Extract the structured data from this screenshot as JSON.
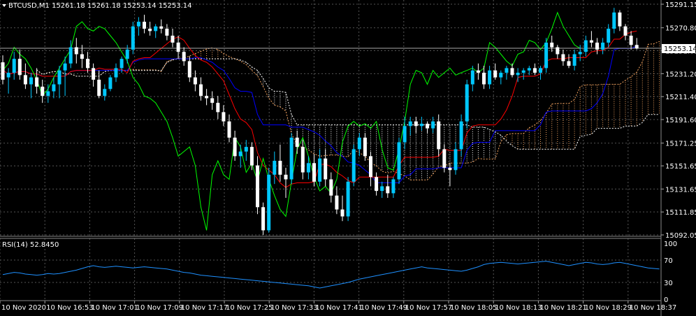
{
  "header": {
    "symbol_line": "BTCUSD,M1  15261.18 15261.18 15253.14 15253.14"
  },
  "rsi_header": {
    "label": "RSI(14) 52.8450"
  },
  "colors": {
    "background": "#000000",
    "grid": "#555555",
    "bull_candle": "#00c8ff",
    "bear_candle": "#ffffff",
    "tenkan": "#ff0000",
    "kijun": "#0000ff",
    "chikou": "#00ff00",
    "senkou_a": "#f4a460",
    "senkou_b": "#ffffff",
    "rsi_line": "#1e90ff",
    "price_tag_bg": "#ffffff",
    "price_tag_text": "#000000"
  },
  "chart_data": {
    "type": "candlestick",
    "symbol": "BTCUSD",
    "timeframe": "M1",
    "ohlc_latest": {
      "open": 15261.18,
      "high": 15261.18,
      "low": 15253.14,
      "close": 15253.14
    },
    "current_price": 15253.14,
    "price_ticks": [
      "15291.15",
      "15270.80",
      "15251.05",
      "15231.20",
      "15211.40",
      "15191.60",
      "15171.25",
      "15151.65",
      "15131.65",
      "15111.85",
      "15092.05"
    ],
    "price_axis": {
      "min": 15092.05,
      "max": 15291.15
    },
    "x_tick_labels": [
      "10 Nov 2020",
      "10 Nov 16:53",
      "10 Nov 17:01",
      "10 Nov 17:09",
      "10 Nov 17:17",
      "10 Nov 17:25",
      "10 Nov 17:33",
      "10 Nov 17:41",
      "10 Nov 17:49",
      "10 Nov 17:57",
      "10 Nov 18:05",
      "10 Nov 18:13",
      "10 Nov 18:21",
      "10 Nov 18:29",
      "10 Nov 18:37"
    ],
    "candles": [
      [
        15241,
        15247,
        15222,
        15226
      ],
      [
        15228,
        15236,
        15214,
        15232
      ],
      [
        15232,
        15250,
        15226,
        15244
      ],
      [
        15244,
        15252,
        15226,
        15230
      ],
      [
        15230,
        15240,
        15218,
        15222
      ],
      [
        15222,
        15232,
        15210,
        15228
      ],
      [
        15228,
        15236,
        15214,
        15220
      ],
      [
        15220,
        15226,
        15206,
        15212
      ],
      [
        15212,
        15222,
        15206,
        15216
      ],
      [
        15216,
        15228,
        15210,
        15222
      ],
      [
        15222,
        15238,
        15210,
        15234
      ],
      [
        15234,
        15246,
        15212,
        15240
      ],
      [
        15240,
        15260,
        15236,
        15254
      ],
      [
        15254,
        15262,
        15240,
        15248
      ],
      [
        15248,
        15256,
        15236,
        15244
      ],
      [
        15244,
        15250,
        15232,
        15236
      ],
      [
        15236,
        15240,
        15220,
        15226
      ],
      [
        15226,
        15234,
        15210,
        15212
      ],
      [
        15212,
        15222,
        15208,
        15218
      ],
      [
        15218,
        15230,
        15216,
        15228
      ],
      [
        15228,
        15240,
        15224,
        15236
      ],
      [
        15236,
        15246,
        15232,
        15244
      ],
      [
        15244,
        15256,
        15240,
        15252
      ],
      [
        15252,
        15276,
        15248,
        15272
      ],
      [
        15272,
        15280,
        15264,
        15276
      ],
      [
        15276,
        15282,
        15266,
        15270
      ],
      [
        15270,
        15276,
        15264,
        15268
      ],
      [
        15268,
        15274,
        15262,
        15272
      ],
      [
        15272,
        15278,
        15266,
        15270
      ],
      [
        15270,
        15274,
        15260,
        15264
      ],
      [
        15264,
        15270,
        15254,
        15258
      ],
      [
        15258,
        15264,
        15244,
        15250
      ],
      [
        15250,
        15254,
        15238,
        15242
      ],
      [
        15242,
        15246,
        15224,
        15228
      ],
      [
        15228,
        15234,
        15216,
        15222
      ],
      [
        15222,
        15228,
        15208,
        15212
      ],
      [
        15212,
        15218,
        15204,
        15210
      ],
      [
        15210,
        15216,
        15200,
        15206
      ],
      [
        15206,
        15212,
        15192,
        15198
      ],
      [
        15198,
        15204,
        15186,
        15190
      ],
      [
        15190,
        15196,
        15172,
        15176
      ],
      [
        15176,
        15182,
        15156,
        15160
      ],
      [
        15160,
        15170,
        15150,
        15164
      ],
      [
        15164,
        15174,
        15156,
        15168
      ],
      [
        15168,
        15172,
        15148,
        15152
      ],
      [
        15152,
        15160,
        15110,
        15116
      ],
      [
        15116,
        15120,
        15092,
        15096
      ],
      [
        15096,
        15150,
        15094,
        15144
      ],
      [
        15144,
        15164,
        15136,
        15156
      ],
      [
        15156,
        15170,
        15138,
        15144
      ],
      [
        15144,
        15150,
        15124,
        15140
      ],
      [
        15140,
        15180,
        15136,
        15176
      ],
      [
        15176,
        15182,
        15162,
        15168
      ],
      [
        15168,
        15174,
        15140,
        15146
      ],
      [
        15146,
        15160,
        15140,
        15154
      ],
      [
        15154,
        15162,
        15134,
        15138
      ],
      [
        15138,
        15166,
        15134,
        15158
      ],
      [
        15158,
        15166,
        15134,
        15140
      ],
      [
        15140,
        15146,
        15120,
        15126
      ],
      [
        15126,
        15134,
        15110,
        15114
      ],
      [
        15114,
        15126,
        15104,
        15108
      ],
      [
        15108,
        15142,
        15104,
        15138
      ],
      [
        15138,
        15170,
        15134,
        15166
      ],
      [
        15166,
        15180,
        15160,
        15176
      ],
      [
        15176,
        15180,
        15156,
        15160
      ],
      [
        15160,
        15164,
        15134,
        15142
      ],
      [
        15142,
        15146,
        15126,
        15130
      ],
      [
        15130,
        15138,
        15124,
        15134
      ],
      [
        15134,
        15144,
        15124,
        15128
      ],
      [
        15128,
        15142,
        15124,
        15140
      ],
      [
        15140,
        15176,
        15136,
        15172
      ],
      [
        15172,
        15194,
        15166,
        15186
      ],
      [
        15186,
        15194,
        15178,
        15190
      ],
      [
        15190,
        15194,
        15180,
        15186
      ],
      [
        15186,
        15194,
        15182,
        15188
      ],
      [
        15188,
        15190,
        15180,
        15184
      ],
      [
        15184,
        15194,
        15180,
        15190
      ],
      [
        15190,
        15196,
        15160,
        15166
      ],
      [
        15166,
        15170,
        15146,
        15150
      ],
      [
        15150,
        15154,
        15134,
        15148
      ],
      [
        15148,
        15172,
        15144,
        15166
      ],
      [
        15166,
        15196,
        15160,
        15190
      ],
      [
        15190,
        15226,
        15184,
        15222
      ],
      [
        15222,
        15238,
        15216,
        15234
      ],
      [
        15234,
        15240,
        15226,
        15232
      ],
      [
        15232,
        15238,
        15218,
        15222
      ],
      [
        15222,
        15238,
        15218,
        15234
      ],
      [
        15234,
        15240,
        15226,
        15228
      ],
      [
        15228,
        15234,
        15222,
        15232
      ],
      [
        15232,
        15238,
        15226,
        15236
      ],
      [
        15236,
        15240,
        15228,
        15230
      ],
      [
        15230,
        15236,
        15224,
        15232
      ],
      [
        15232,
        15236,
        15226,
        15234
      ],
      [
        15234,
        15238,
        15230,
        15236
      ],
      [
        15236,
        15240,
        15230,
        15232
      ],
      [
        15232,
        15238,
        15226,
        15236
      ],
      [
        15236,
        15262,
        15232,
        15258
      ],
      [
        15258,
        15264,
        15250,
        15254
      ],
      [
        15254,
        15256,
        15244,
        15248
      ],
      [
        15248,
        15252,
        15238,
        15242
      ],
      [
        15242,
        15248,
        15236,
        15238
      ],
      [
        15238,
        15252,
        15234,
        15248
      ],
      [
        15248,
        15256,
        15242,
        15250
      ],
      [
        15250,
        15264,
        15246,
        15260
      ],
      [
        15260,
        15268,
        15254,
        15258
      ],
      [
        15258,
        15262,
        15248,
        15252
      ],
      [
        15252,
        15262,
        15248,
        15258
      ],
      [
        15258,
        15274,
        15254,
        15270
      ],
      [
        15270,
        15288,
        15266,
        15284
      ],
      [
        15284,
        15286,
        15268,
        15272
      ],
      [
        15272,
        15274,
        15260,
        15264
      ],
      [
        15264,
        15268,
        15252,
        15256
      ],
      [
        15256,
        15262,
        15252,
        15253
      ]
    ],
    "rsi": {
      "name": "RSI(14)",
      "latest": 52.845,
      "levels": [
        70,
        30
      ],
      "scale_ticks": [
        "100",
        "70",
        "30",
        "0"
      ],
      "values": [
        44,
        46,
        48,
        47,
        45,
        44,
        43,
        44,
        46,
        45,
        46,
        48,
        50,
        52,
        55,
        58,
        60,
        58,
        57,
        58,
        59,
        58,
        57,
        56,
        57,
        58,
        57,
        56,
        55,
        54,
        52,
        50,
        48,
        47,
        45,
        43,
        42,
        41,
        40,
        39,
        38,
        37,
        36,
        35,
        34,
        33,
        32,
        31,
        30,
        29,
        28,
        27,
        26,
        25,
        24,
        22,
        20,
        22,
        24,
        26,
        28,
        30,
        33,
        36,
        38,
        40,
        42,
        44,
        46,
        48,
        50,
        52,
        54,
        56,
        58,
        56,
        55,
        54,
        53,
        52,
        51,
        50,
        52,
        55,
        58,
        62,
        64,
        65,
        66,
        65,
        64,
        63,
        64,
        65,
        66,
        67,
        68,
        66,
        64,
        62,
        60,
        62,
        64,
        66,
        65,
        63,
        62,
        63,
        65,
        66,
        64,
        62,
        60,
        58,
        56,
        55,
        54,
        56,
        58,
        55,
        53,
        52.8
      ]
    }
  }
}
